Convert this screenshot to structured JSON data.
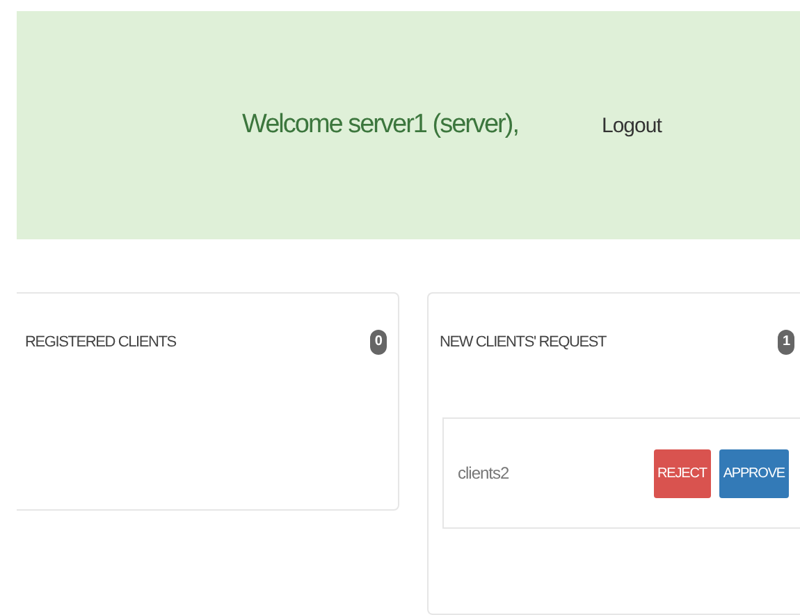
{
  "header": {
    "welcome": "Welcome server1 (server),",
    "logout": "Logout"
  },
  "panels": [
    {
      "title": "REGISTERED CLIENTS",
      "count": "0"
    },
    {
      "title": "NEW CLIENTS' REQUEST",
      "count": "1",
      "requests": [
        {
          "name": "clients2",
          "actions": [
            {
              "label": "REJECT",
              "kind": "danger"
            },
            {
              "label": "APPROVE",
              "kind": "primary"
            }
          ]
        }
      ]
    }
  ]
}
